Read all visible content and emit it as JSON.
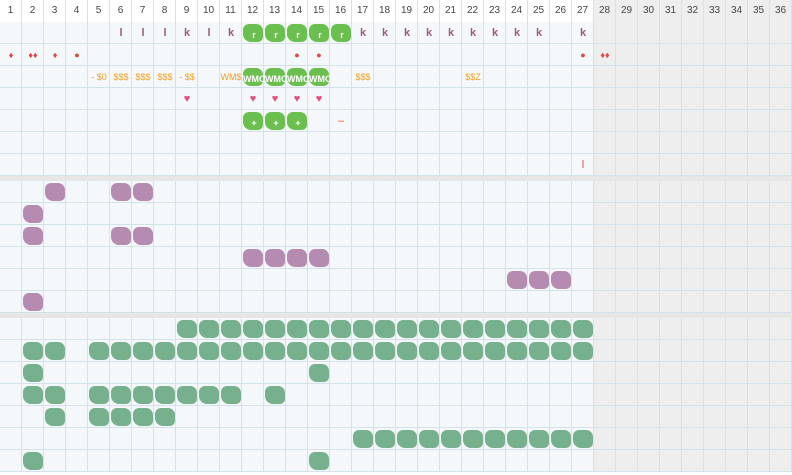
{
  "columns": [
    "1",
    "2",
    "3",
    "4",
    "5",
    "6",
    "7",
    "8",
    "9",
    "10",
    "11",
    "12",
    "13",
    "14",
    "15",
    "16",
    "17",
    "18",
    "19",
    "20",
    "21",
    "22",
    "23",
    "24",
    "25",
    "26",
    "27",
    "28",
    "29",
    "30",
    "31",
    "32",
    "33",
    "34",
    "35",
    "36"
  ],
  "active_columns": 27,
  "colors": {
    "grid_bg": "#f4f8fa",
    "grid_line": "#d4e2ec",
    "inactive_bg": "#eeeeee",
    "section_gap": "#e6e6e6",
    "letter": "#9a5a85",
    "drop": "#e04848",
    "heart": "#e0507a",
    "money": "#f0a020",
    "minus": "#f06020"
  },
  "section1": {
    "row1_letters": [
      {
        "col": 6,
        "text": "l"
      },
      {
        "col": 7,
        "text": "l"
      },
      {
        "col": 8,
        "text": "l"
      },
      {
        "col": 9,
        "text": "k"
      },
      {
        "col": 10,
        "text": "l"
      },
      {
        "col": 11,
        "text": "k"
      },
      {
        "col": 16,
        "text": "k"
      },
      {
        "col": 17,
        "text": "k"
      },
      {
        "col": 18,
        "text": "k"
      },
      {
        "col": 19,
        "text": "k"
      },
      {
        "col": 20,
        "text": "k"
      },
      {
        "col": 21,
        "text": "k"
      },
      {
        "col": 22,
        "text": "k"
      },
      {
        "col": 23,
        "text": "k"
      },
      {
        "col": 24,
        "text": "k"
      },
      {
        "col": 25,
        "text": "k"
      },
      {
        "col": 27,
        "text": "k"
      }
    ],
    "row1_blobs": [
      {
        "col": 12,
        "text": "r"
      },
      {
        "col": 13,
        "text": "r"
      },
      {
        "col": 14,
        "text": "r"
      },
      {
        "col": 15,
        "text": "r"
      },
      {
        "col": 16,
        "text": "r"
      }
    ],
    "row2_symbols": [
      {
        "col": 1,
        "icon": "triple-drop-icon",
        "text": "♦"
      },
      {
        "col": 2,
        "icon": "double-drop-icon",
        "text": "♦♦"
      },
      {
        "col": 3,
        "icon": "drop-icon",
        "text": "♦"
      },
      {
        "col": 4,
        "icon": "dot-icon",
        "text": "●"
      },
      {
        "col": 14,
        "icon": "dot-icon",
        "text": "●"
      },
      {
        "col": 15,
        "icon": "dot-icon",
        "text": "●"
      },
      {
        "col": 27,
        "icon": "dot-icon",
        "text": "●"
      },
      {
        "col": 28,
        "icon": "double-drop-icon",
        "text": "♦♦"
      }
    ],
    "row3_money": [
      {
        "col": 5,
        "text": "- $0"
      },
      {
        "col": 6,
        "text": "$$$"
      },
      {
        "col": 7,
        "text": "$$$"
      },
      {
        "col": 8,
        "text": "$$$"
      },
      {
        "col": 9,
        "text": "- $$"
      },
      {
        "col": 11,
        "text": "WM$"
      },
      {
        "col": 17,
        "text": "$$$"
      },
      {
        "col": 22,
        "text": "$$Z"
      }
    ],
    "row3_blobs": [
      {
        "col": 12,
        "text": "WMO"
      },
      {
        "col": 13,
        "text": "WMO"
      },
      {
        "col": 14,
        "text": "WMO"
      },
      {
        "col": 15,
        "text": "WMO"
      }
    ],
    "row5_hearts": [
      {
        "col": 9,
        "text": "♥"
      },
      {
        "col": 12,
        "text": "♥"
      },
      {
        "col": 13,
        "text": "♥"
      },
      {
        "col": 14,
        "text": "♥"
      },
      {
        "col": 15,
        "text": "♥"
      }
    ],
    "row6_blobs": [
      {
        "col": 12,
        "text": "+"
      },
      {
        "col": 13,
        "text": "+"
      },
      {
        "col": 14,
        "text": "+"
      }
    ],
    "row6_minus": {
      "col": 16,
      "text": "–"
    },
    "row8_mark": {
      "col": 27,
      "text": "l"
    }
  },
  "section2_rows": [
    [
      3,
      6,
      7
    ],
    [
      2
    ],
    [
      2,
      6,
      7
    ],
    [
      12,
      13,
      14,
      15
    ],
    [
      24,
      25,
      26
    ],
    [
      2
    ]
  ],
  "section3_rows": [
    [
      9,
      10,
      11,
      12,
      13,
      14,
      15,
      16,
      17,
      18,
      19,
      20,
      21,
      22,
      23,
      24,
      25,
      26,
      27
    ],
    [
      2,
      3,
      5,
      6,
      7,
      8,
      9,
      10,
      11,
      12,
      13,
      14,
      15,
      16,
      17,
      18,
      19,
      20,
      21,
      22,
      23,
      24,
      25,
      26,
      27
    ],
    [
      2,
      15
    ],
    [
      2,
      3,
      5,
      6,
      7,
      8,
      9,
      10,
      11,
      13
    ],
    [
      3,
      5,
      6,
      7,
      8
    ],
    [
      17,
      18,
      19,
      20,
      21,
      22,
      23,
      24,
      25,
      26,
      27
    ],
    [
      2,
      15
    ]
  ]
}
